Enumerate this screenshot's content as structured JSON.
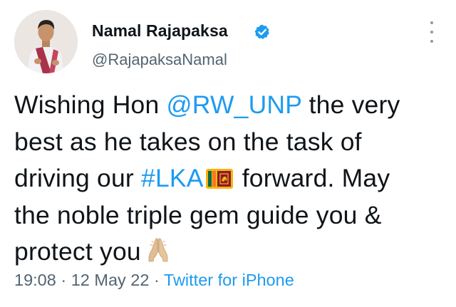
{
  "author": {
    "name": "Namal Rajapaksa",
    "handle": "@RajapaksaNamal",
    "verified": true,
    "avatar_icon": "profile-photo"
  },
  "tweet": {
    "line1_prefix": "Wishing Hon ",
    "mention": "@RW_UNP",
    "line1_suffix": " the very",
    "line2": "best as he takes on the task of",
    "line3_prefix": "driving our ",
    "hashtag": "#LKA",
    "line3_suffix": " forward. May",
    "line4": "the noble triple gem guide you &",
    "line5": "protect you",
    "emoji": [
      "sri-lanka-flag-icon",
      "folded-hands-icon"
    ]
  },
  "meta": {
    "time": "19:08",
    "separator": " · ",
    "date": "12 May 22",
    "source": "Twitter for iPhone"
  },
  "colors": {
    "link": "#1d9bf0",
    "text": "#0f1419",
    "secondary": "#536471"
  }
}
